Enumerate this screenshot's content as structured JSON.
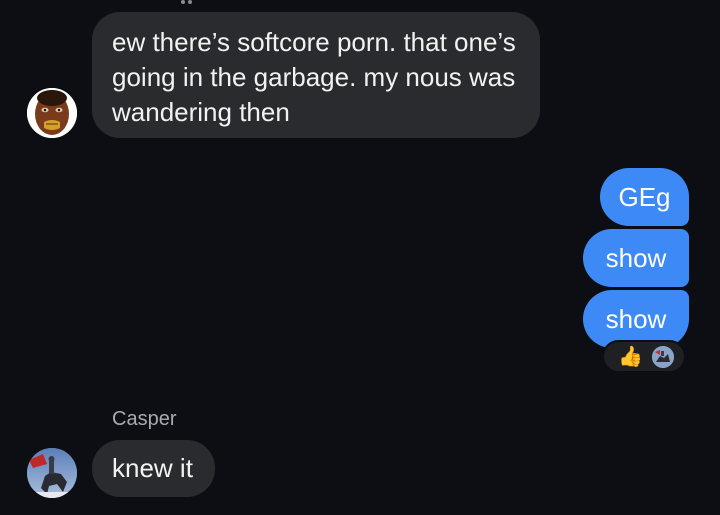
{
  "messages": {
    "first": {
      "line1": "ew there’s softcore porn. that one’s",
      "line2": "going in the garbage. my nous was",
      "line3": "wandering then"
    },
    "outgoing": [
      "GEg",
      "show",
      "show"
    ],
    "casper": {
      "sender": "Casper",
      "text": "knew it"
    }
  },
  "reactions": {
    "emoji_icon": "thumbs-up-icon",
    "emoji": "👍",
    "reactor_avatar": "avatar"
  },
  "colors": {
    "background": "#0c0e14",
    "incoming_bubble": "#2a2b2f",
    "outgoing_bubble": "#3d8af7",
    "sender_name": "#a9abb0"
  }
}
